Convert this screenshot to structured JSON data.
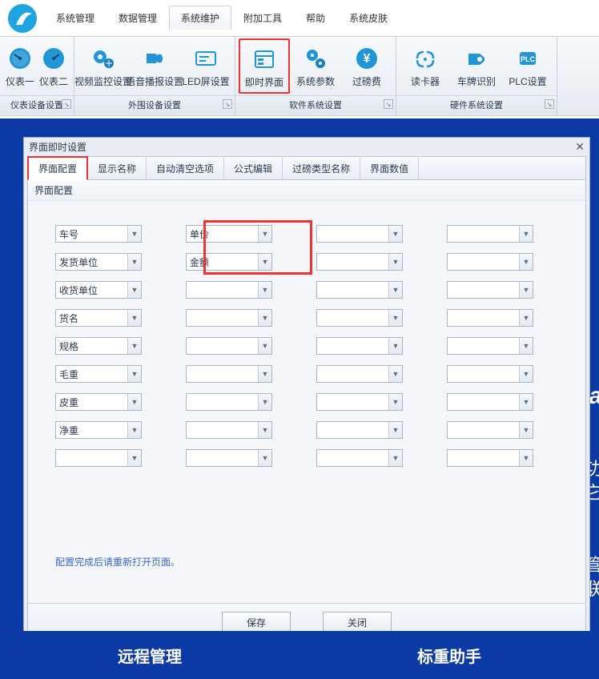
{
  "menu": {
    "tabs": [
      "系统管理",
      "数据管理",
      "系统维护",
      "附加工具",
      "帮助",
      "系统皮肤"
    ],
    "active": 2
  },
  "ribbon": {
    "groups": [
      {
        "title": "仪表设备设置",
        "items": [
          {
            "label": "仪表一"
          },
          {
            "label": "仪表二"
          }
        ]
      },
      {
        "title": "外围设备设置",
        "items": [
          {
            "label": "视频监控设置"
          },
          {
            "label": "语音播报设置"
          },
          {
            "label": "LED屏设置"
          }
        ]
      },
      {
        "title": "软件系统设置",
        "items": [
          {
            "label": "即时界面",
            "highlighted": true
          },
          {
            "label": "系统参数"
          },
          {
            "label": "过磅费"
          }
        ]
      },
      {
        "title": "硬件系统设置",
        "items": [
          {
            "label": "读卡器"
          },
          {
            "label": "车牌识别"
          },
          {
            "label": "PLC设置"
          }
        ]
      }
    ]
  },
  "dialog": {
    "title": "界面即时设置",
    "tabs": [
      "界面配置",
      "显示名称",
      "自动清空选项",
      "公式编辑",
      "过磅类型名称",
      "界面数值"
    ],
    "activeTab": 0,
    "subHeader": "界面配置",
    "cells": [
      [
        "车号",
        "单价",
        "",
        ""
      ],
      [
        "发货单位",
        "金额",
        "",
        ""
      ],
      [
        "收货单位",
        "",
        "",
        ""
      ],
      [
        "货名",
        "",
        "",
        ""
      ],
      [
        "规格",
        "",
        "",
        ""
      ],
      [
        "毛重",
        "",
        "",
        ""
      ],
      [
        "皮重",
        "",
        "",
        ""
      ],
      [
        "净重",
        "",
        "",
        ""
      ],
      [
        "",
        "",
        "",
        ""
      ]
    ],
    "note": "配置完成后请重新打开页面。",
    "buttons": {
      "save": "保存",
      "close": "关闭"
    }
  },
  "bgBottom": {
    "left": "远程管理",
    "right": "标重助手"
  },
  "bgSide": {
    "a": "ra",
    "b": "功",
    "c": "其它",
    "d": "管",
    "e": "联"
  }
}
